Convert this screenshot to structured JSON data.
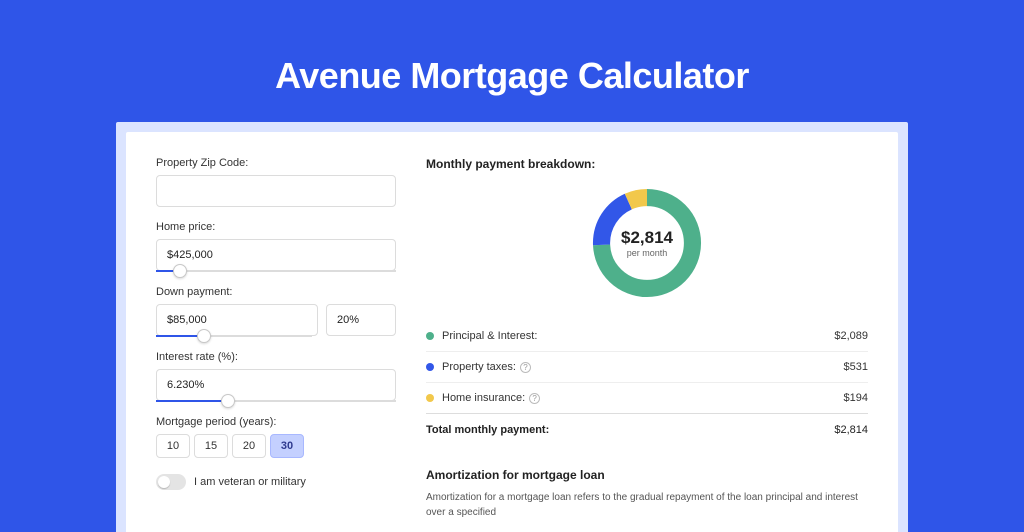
{
  "title": "Avenue Mortgage Calculator",
  "form": {
    "zip_label": "Property Zip Code:",
    "zip_value": "",
    "home_price_label": "Home price:",
    "home_price_value": "$425,000",
    "home_price_slider_pct": 10,
    "down_payment_label": "Down payment:",
    "down_payment_value": "$85,000",
    "down_payment_pct_value": "20%",
    "down_payment_slider_pct": 20,
    "interest_label": "Interest rate (%):",
    "interest_value": "6.230%",
    "interest_slider_pct": 30,
    "period_label": "Mortgage period (years):",
    "periods": [
      "10",
      "15",
      "20",
      "30"
    ],
    "period_selected_index": 3,
    "veteran_label": "I am veteran or military"
  },
  "breakdown": {
    "heading": "Monthly payment breakdown:",
    "center_value": "$2,814",
    "center_sub": "per month",
    "items": [
      {
        "label": "Principal & Interest:",
        "value": "$2,089",
        "color": "#4eb08b",
        "help": false
      },
      {
        "label": "Property taxes:",
        "value": "$531",
        "color": "#3257e8",
        "help": true
      },
      {
        "label": "Home insurance:",
        "value": "$194",
        "color": "#f2c84b",
        "help": true
      }
    ],
    "total_label": "Total monthly payment:",
    "total_value": "$2,814"
  },
  "amortization": {
    "heading": "Amortization for mortgage loan",
    "text": "Amortization for a mortgage loan refers to the gradual repayment of the loan principal and interest over a specified"
  },
  "chart_data": {
    "type": "pie",
    "title": "Monthly payment breakdown",
    "categories": [
      "Principal & Interest",
      "Property taxes",
      "Home insurance"
    ],
    "values": [
      2089,
      531,
      194
    ],
    "colors": [
      "#4eb08b",
      "#3257e8",
      "#f2c84b"
    ],
    "total": 2814,
    "center_label": "$2,814 per month"
  }
}
